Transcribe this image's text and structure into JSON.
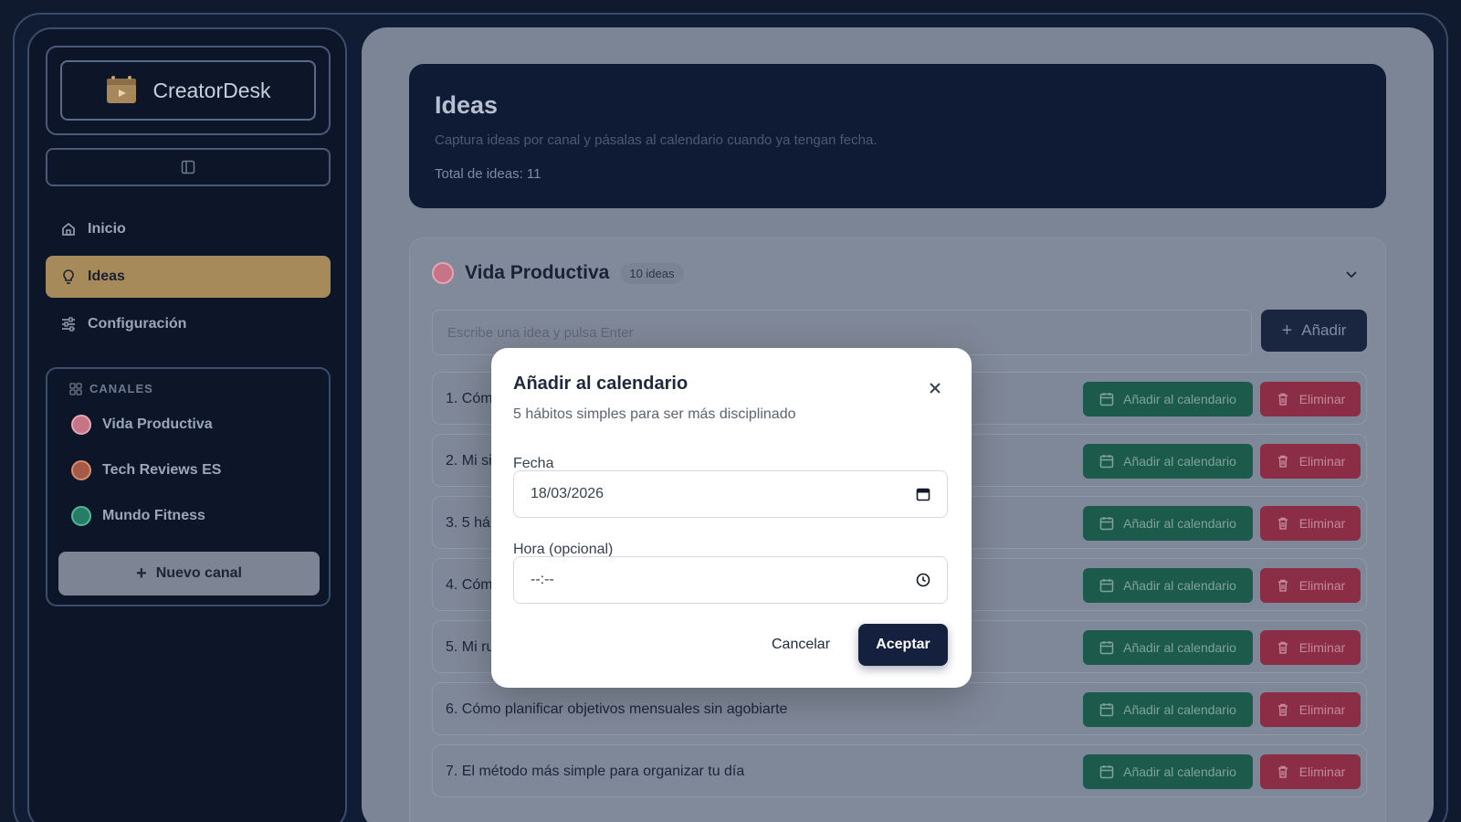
{
  "sidebar": {
    "brand": "CreatorDesk",
    "nav": [
      {
        "label": "Inicio",
        "icon": "home-icon"
      },
      {
        "label": "Ideas",
        "icon": "lightbulb-icon",
        "active": true
      },
      {
        "label": "Configuración",
        "icon": "sliders-icon"
      }
    ],
    "channels_title": "CANALES",
    "channels": [
      {
        "label": "Vida Productiva",
        "color": "#d97a8f"
      },
      {
        "label": "Tech Reviews ES",
        "color": "#c0614a"
      },
      {
        "label": "Mundo Fitness",
        "color": "#2f9a7a"
      }
    ],
    "new_channel": "Nuevo canal"
  },
  "header": {
    "title": "Ideas",
    "subtitle": "Captura ideas por canal y pásalas al calendario cuando ya tengan fecha.",
    "total": "Total de ideas: 11"
  },
  "channel_card": {
    "title": "Vida Productiva",
    "count": "10 ideas",
    "input_placeholder": "Escribe una idea y pulsa Enter",
    "add_label": "Añadir",
    "calendar_label": "Añadir al calendario",
    "delete_label": "Eliminar",
    "ideas": [
      "1. Cóm",
      "2. Mi si",
      "3. 5 há",
      "4. Cóm",
      "5. Mi ru",
      "6. Cómo planificar objetivos mensuales sin agobiarte",
      "7. El método más simple para organizar tu día"
    ]
  },
  "modal": {
    "title": "Añadir al calendario",
    "subtitle": "5 hábitos simples para ser más disciplinado",
    "date_label": "Fecha",
    "date_value": "18/03/2026",
    "time_label": "Hora (opcional)",
    "time_value": "--:--",
    "cancel": "Cancelar",
    "accept": "Aceptar"
  }
}
